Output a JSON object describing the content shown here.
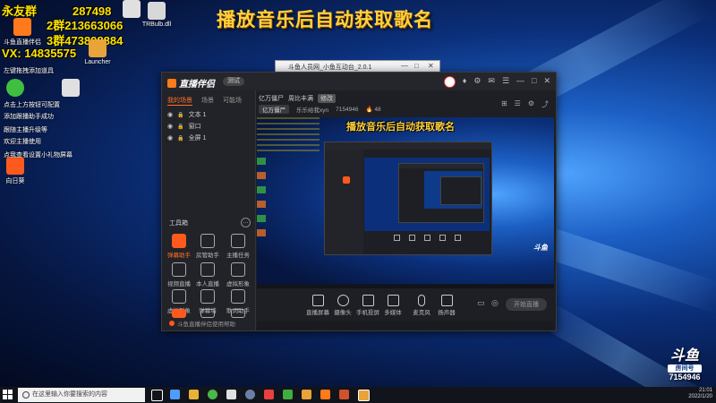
{
  "headline": "播放音乐后自动获取歌名",
  "overlay": {
    "line1": "永友群",
    "line1_num": "287498",
    "line2": "2群213663066",
    "line3": "3群473898884",
    "line4": "VX: 14835575"
  },
  "desktop_icons": [
    {
      "label": "斗鱼直播伴侣",
      "color": "#ff7a1a"
    },
    {
      "label": "",
      "color": "#e0e0e0"
    },
    {
      "label": "TRBulb.dll",
      "color": "#d8d8d8"
    },
    {
      "label": "Launcher",
      "color": "#e8a33a"
    },
    {
      "label": "",
      "color": "#3fbf3f"
    },
    {
      "label": "",
      "color": "#e0e0e0"
    },
    {
      "label": "向日葵",
      "color": "#ff5a1e"
    }
  ],
  "desktop_sidetext": [
    "左键拖拽添加道具",
    "点击上方按钮可配置",
    "添加跟播助手成功",
    "跟随主播升级等",
    "欢迎主播使用",
    "点我查看设置小礼物屏幕"
  ],
  "mini_window": {
    "title": "斗鱼人员网_小鱼互动台_2.0.1",
    "min": "—",
    "max": "□",
    "close": "✕"
  },
  "app": {
    "logo": "直播伴侣",
    "version": "测试",
    "title_icons": [
      "♦",
      "⚙",
      "✉",
      "☰",
      "—",
      "□",
      "✕"
    ],
    "tabs": [
      "我的场景",
      "场景",
      "可能场"
    ],
    "scenes": [
      {
        "vis": "◉",
        "lock": "🔒",
        "name": "文本 1"
      },
      {
        "vis": "◉",
        "lock": "🔒",
        "name": "窗口"
      },
      {
        "vis": "◉",
        "lock": "🔒",
        "name": "全屏 1"
      }
    ],
    "tools_title": "工具箱",
    "tools_more": "…",
    "tools": [
      {
        "label": "弹幕助手",
        "hot": true
      },
      {
        "label": "房管助手",
        "hot": false
      },
      {
        "label": "主播任务",
        "hot": false
      },
      {
        "label": "视频直播",
        "hot": false
      },
      {
        "label": "本人直播",
        "hot": false
      },
      {
        "label": "虚拟形象",
        "hot": false
      },
      {
        "label": "虚拟形象",
        "hot": false
      },
      {
        "label": "弹幕墙",
        "hot": false
      },
      {
        "label": "歌词助手",
        "hot": false
      },
      {
        "label": "",
        "hot": true
      },
      {
        "label": "",
        "hot": false
      },
      {
        "label": "",
        "hot": false
      }
    ],
    "bottom_note": "斗鱼直播伴侣使用帮助",
    "room_header": {
      "name": "亿万僵尸",
      "category": "周比丰满",
      "badge": "修改"
    },
    "room_sub": {
      "chip": "亿万僵尸",
      "host": "乐乐给我xyn",
      "room_id": "7154946",
      "hot": "🔥 48"
    },
    "right_icons": [
      "⊞",
      "☰",
      "⚙",
      "⤴"
    ],
    "preview_headline": "播放音乐后自动获取歌名",
    "controls": [
      {
        "label": "直播屏幕"
      },
      {
        "label": "摄像头"
      },
      {
        "label": "手机投屏"
      },
      {
        "label": "多媒体"
      },
      {
        "label": "麦克风"
      },
      {
        "label": "扬声器"
      }
    ],
    "ctrl_right": [
      "▭",
      "◎",
      "⚙"
    ],
    "go_live": "开始直播"
  },
  "taskbar": {
    "search_placeholder": "在这里输入你要搜索的内容",
    "time": "21:01",
    "date": "2022/1/20",
    "icons": [
      "#ffffff",
      "#4e9cff",
      "#4ab84a",
      "#e0e0e0",
      "#b0b0b0",
      "#e84040",
      "#3fae3f",
      "#e8b23a",
      "#ff7a1a",
      "#d0522a",
      "#e8a33a"
    ]
  },
  "douyu": {
    "brand": "斗鱼",
    "room_label": "房间号",
    "room": "7154946"
  }
}
